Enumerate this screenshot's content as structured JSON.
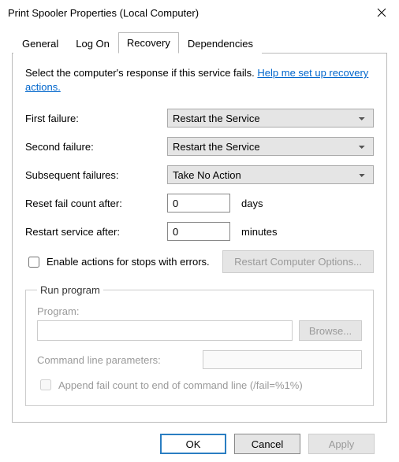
{
  "window": {
    "title": "Print Spooler Properties (Local Computer)"
  },
  "tabs": {
    "general": "General",
    "logon": "Log On",
    "recovery": "Recovery",
    "dependencies": "Dependencies"
  },
  "intro": {
    "text": "Select the computer's response if this service fails. ",
    "link": "Help me set up recovery actions."
  },
  "labels": {
    "first": "First failure:",
    "second": "Second failure:",
    "subsequent": "Subsequent failures:",
    "reset": "Reset fail count after:",
    "restart": "Restart service after:",
    "days": "days",
    "minutes": "minutes",
    "enable_errors": "Enable actions for stops with errors.",
    "restart_options": "Restart Computer Options...",
    "run_program": "Run program",
    "program": "Program:",
    "browse": "Browse...",
    "cmd_params": "Command line parameters:",
    "append": "Append fail count to end of command line (/fail=%1%)"
  },
  "values": {
    "first": "Restart the Service",
    "second": "Restart the Service",
    "subsequent": "Take No Action",
    "reset_days": "0",
    "restart_minutes": "0",
    "program": "",
    "cmd_params": ""
  },
  "buttons": {
    "ok": "OK",
    "cancel": "Cancel",
    "apply": "Apply"
  }
}
